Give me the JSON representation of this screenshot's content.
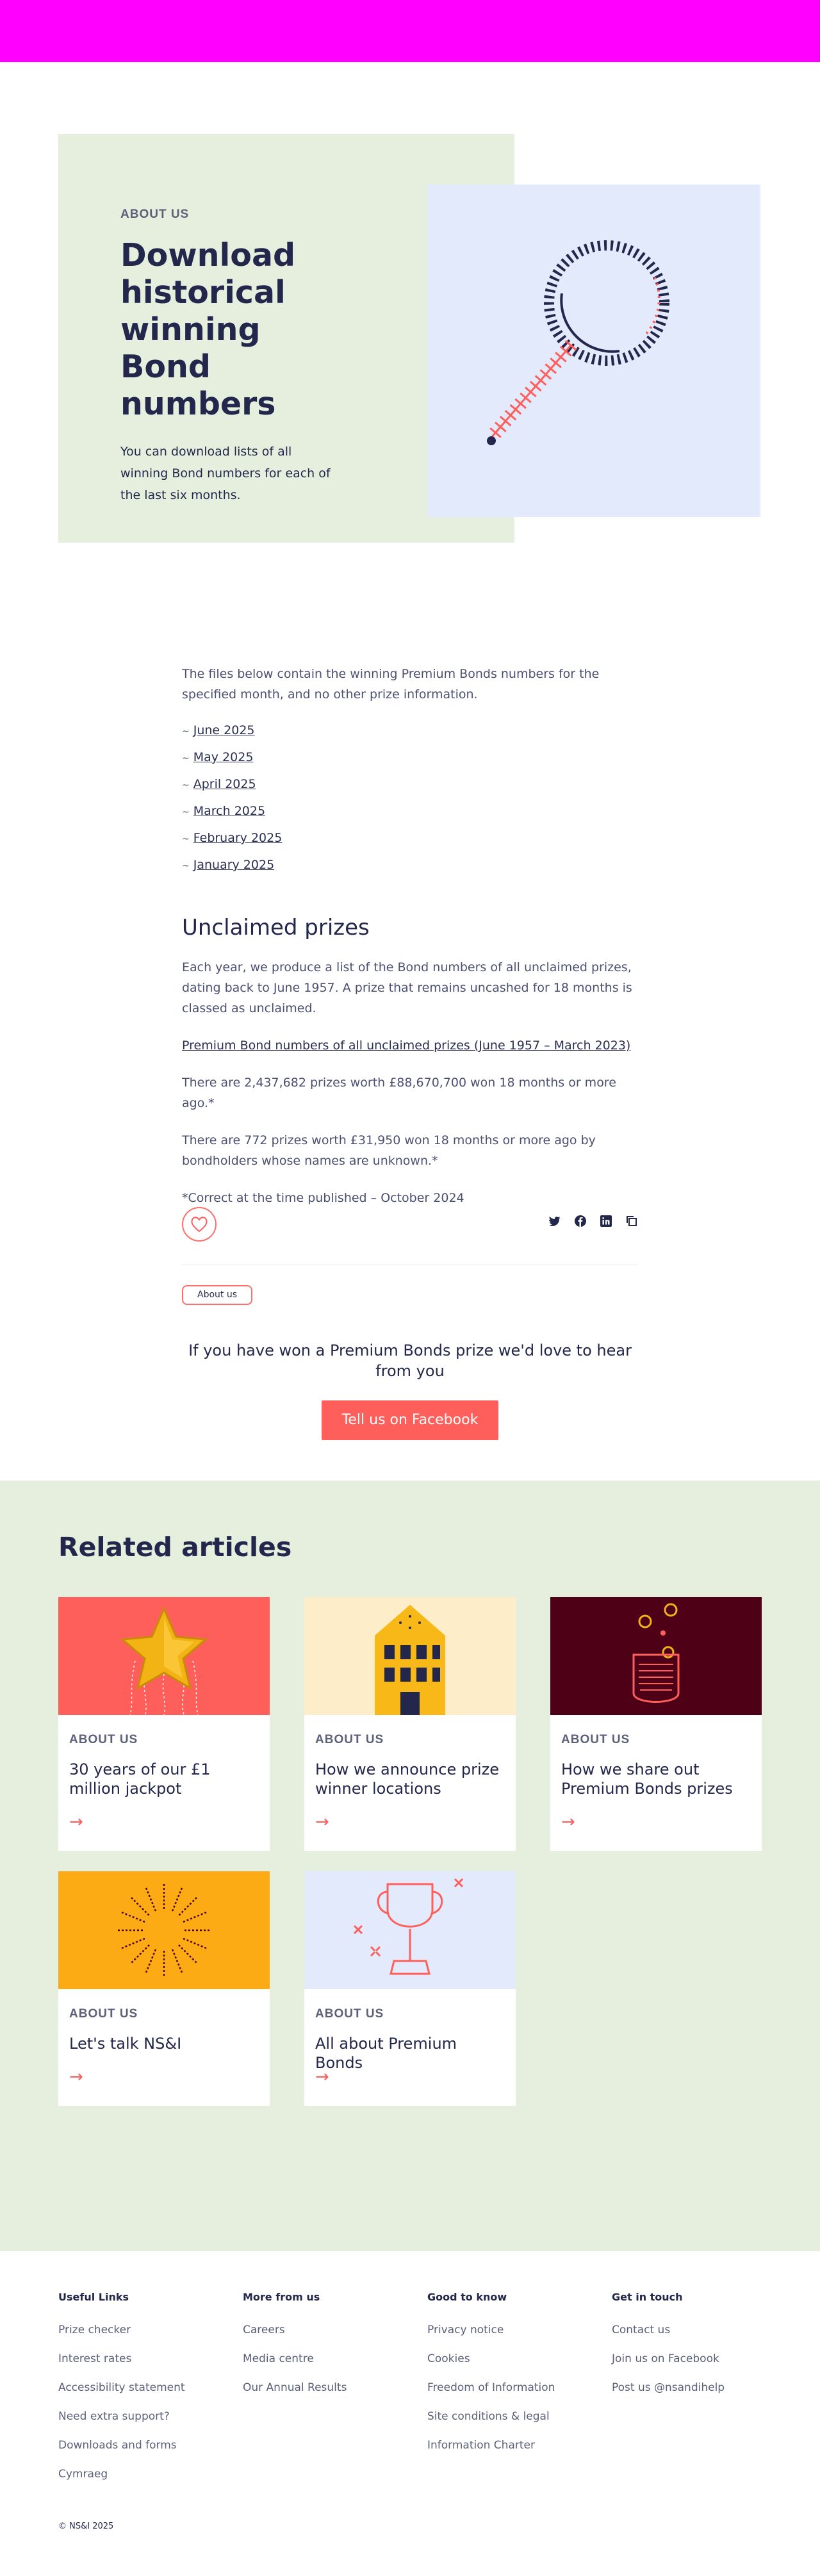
{
  "hero": {
    "eyebrow": "ABOUT US",
    "title": "Download historical winning Bond numbers",
    "description": "You can download lists of all winning Bond numbers for each of the last six months."
  },
  "content": {
    "intro": "The files below contain the winning Premium Bonds numbers for the specified month, and no other prize information.",
    "months": [
      "June 2025",
      "May 2025",
      "April 2025",
      "March 2025",
      "February 2025",
      "January 2025"
    ],
    "unclaimed_title": "Unclaimed prizes",
    "unclaimed_p1": "Each year, we produce a list of the Bond numbers of all unclaimed prizes, dating back to June 1957. A prize that remains uncashed for 18 months is classed as unclaimed.",
    "unclaimed_link": "Premium Bond numbers of all unclaimed prizes (June 1957 – March 2023)",
    "unclaimed_p2": "There are 2,437,682 prizes worth £88,670,700 won 18 months or more ago.*",
    "unclaimed_p3": "There are 772 prizes worth £31,950 won 18 months or more ago by bondholders whose names are unknown.*",
    "footnote": "*Correct at the time published – October 2024"
  },
  "tag_label": "About us",
  "facebook": {
    "text": "If you have won a Premium Bonds prize we'd love to hear from you",
    "button": "Tell us on Facebook"
  },
  "related": {
    "title": "Related articles",
    "cards": [
      {
        "eyebrow": "ABOUT US",
        "title": "30 years of our £1 million jackpot",
        "color": "#ff5f5b"
      },
      {
        "eyebrow": "ABOUT US",
        "title": "How we announce prize winner locations",
        "color": "#fdedc8"
      },
      {
        "eyebrow": "ABOUT US",
        "title": "How we share out Premium Bonds prizes",
        "color": "#4e0017"
      },
      {
        "eyebrow": "ABOUT US",
        "title": "Let's talk NS&I",
        "color": "#fdab14"
      },
      {
        "eyebrow": "ABOUT US",
        "title": "All about Premium Bonds",
        "color": "#e2eafc"
      }
    ]
  },
  "footer": {
    "useful": {
      "heading": "Useful Links",
      "links": [
        "Prize checker",
        "Interest rates",
        "Accessibility statement",
        "Need extra support?",
        "Downloads and forms",
        "Cymraeg"
      ]
    },
    "more": {
      "heading": "More from us",
      "links": [
        "Careers",
        "Media centre",
        "Our Annual Results"
      ]
    },
    "good": {
      "heading": "Good to know",
      "links": [
        "Privacy notice",
        "Cookies",
        "Freedom of Information",
        "Site conditions & legal",
        "Information Charter"
      ]
    },
    "contact": {
      "heading": "Get in touch",
      "links": [
        "Contact us",
        "Join us on Facebook",
        "Post us @nsandihelp"
      ]
    },
    "copyright": "© NS&I 2025"
  },
  "colors": {
    "accent": "#ff5f5b",
    "navy": "#22274b",
    "green_bg": "#e6efdd",
    "blue_bg": "#e2eafc",
    "topbar": "#ff00ff"
  }
}
